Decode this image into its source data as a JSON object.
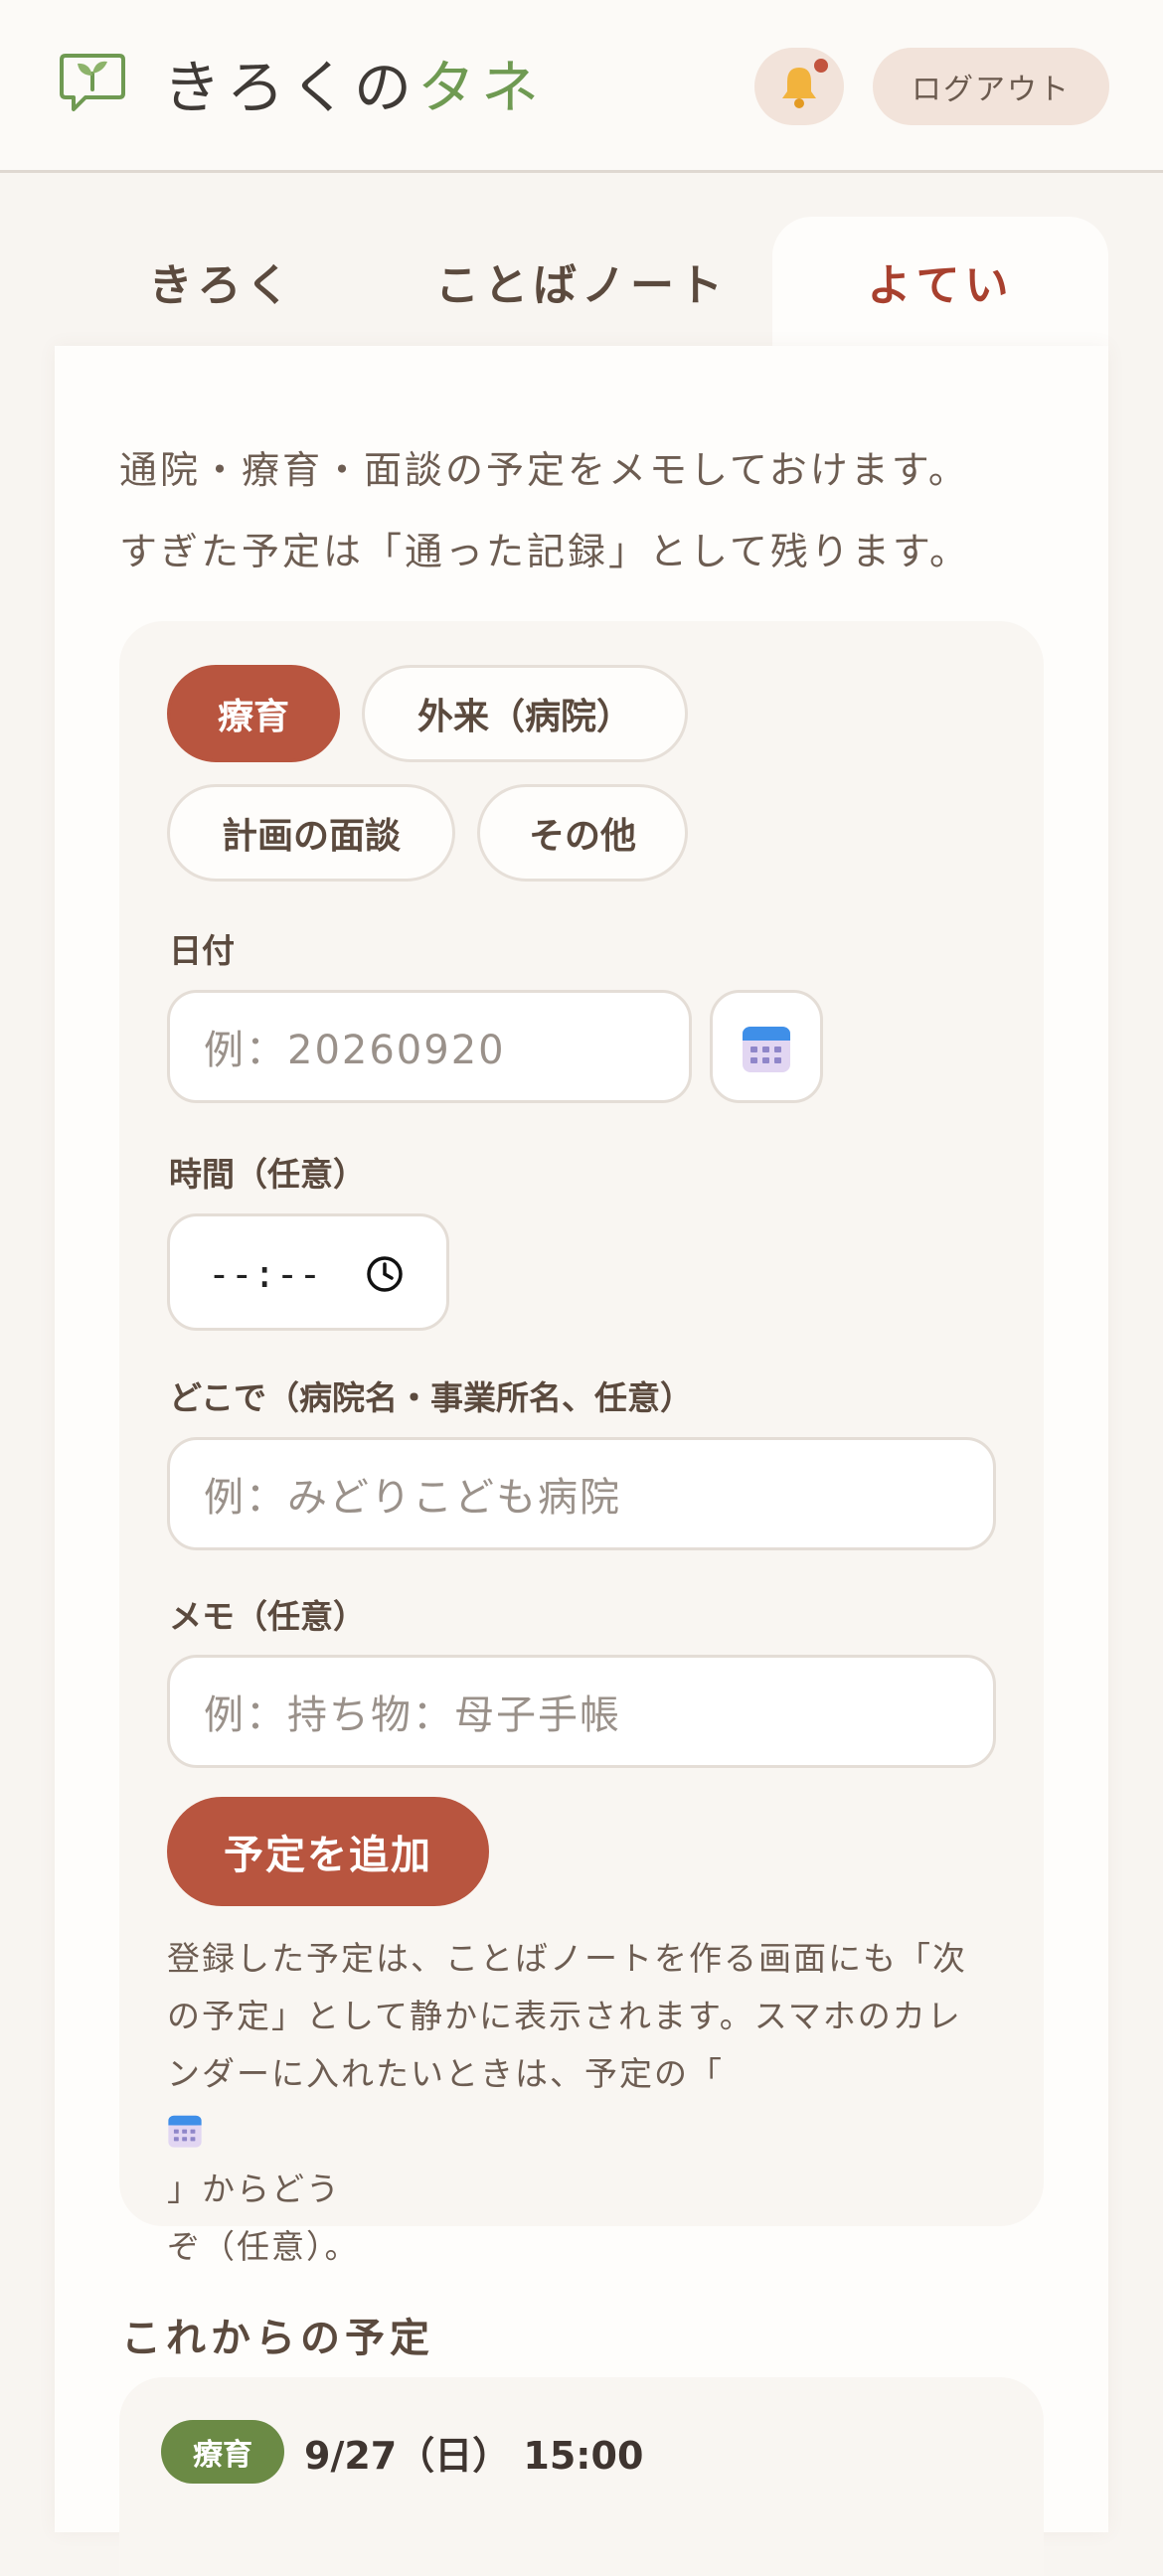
{
  "app": {
    "title_main": "きろくの",
    "title_accent": "タネ",
    "logout_label": "ログアウト"
  },
  "tabs": [
    {
      "label": "きろく",
      "active": false
    },
    {
      "label": "ことばノート",
      "active": false
    },
    {
      "label": "よてい",
      "active": true
    }
  ],
  "intro": [
    "通院・療育・面談の予定をメモしておけます。",
    "すぎた予定は「通った記録」として残ります。"
  ],
  "form": {
    "categories": [
      {
        "label": "療育",
        "selected": true
      },
      {
        "label": "外来（病院）",
        "selected": false
      },
      {
        "label": "計画の面談",
        "selected": false
      },
      {
        "label": "その他",
        "selected": false
      }
    ],
    "date_label": "日付",
    "date_placeholder": "例：20260920",
    "time_label": "時間（任意）",
    "time_value": "--:--",
    "place_label": "どこで（病院名・事業所名、任意）",
    "place_placeholder": "例：みどりこども病院",
    "memo_label": "メモ（任意）",
    "memo_placeholder": "例：持ち物：母子手帳",
    "add_button": "予定を追加",
    "note_lines": [
      "登録した予定は、ことばノートを作る画面にも「次",
      "の予定」として静かに表示されます。スマホのカレ",
      "ンダーに入れたいときは、予定の「",
      "」からどう",
      "ぞ（任意）。"
    ]
  },
  "upcoming": {
    "title": "これからの予定",
    "items": [
      {
        "category": "療育",
        "when": "9/27（日） 15:00"
      }
    ]
  },
  "colors": {
    "accent_brown": "#b8553f",
    "active_tab_text": "#a8402e",
    "logo_green": "#6f9a52",
    "badge_green": "#6b8a45",
    "background": "#f8f5f1"
  },
  "icons": [
    "sprout-speech-icon",
    "bell-icon",
    "calendar-icon",
    "clock-icon"
  ]
}
